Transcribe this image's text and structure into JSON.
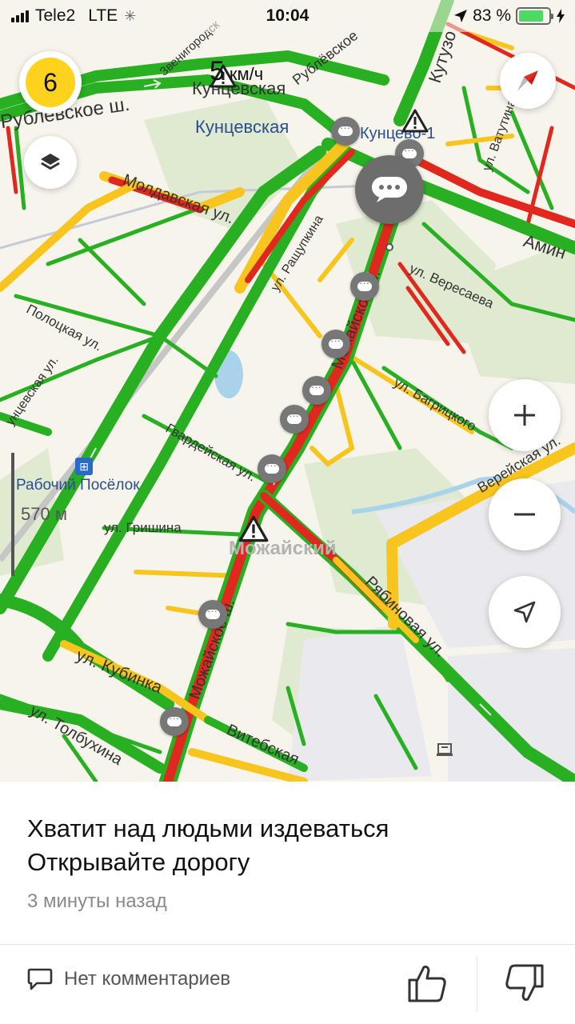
{
  "status_bar": {
    "carrier": "Tele2",
    "network": "LTE",
    "time": "10:04",
    "battery_percent": "83 %",
    "battery_level": 0.83
  },
  "map": {
    "traffic_score": "6",
    "speed_value": "5",
    "speed_unit": "км/ч",
    "scale_label": "570 м",
    "labels": {
      "rublevskoe": "Рублёвское ш.",
      "rublevskoe_top": "Рублёвское",
      "zvenigorodskoe": "Звенигородск",
      "kuntsevskaya_st": "Кунцевская",
      "kuntsevskaya_top": "Кунцевская",
      "kuntsevo1": "Кунцево-1",
      "kutuzovsky": "Кутузо",
      "moldavskaya": "Молдавская ул.",
      "rashchupkina": "ул. Ращупкина",
      "mozhayskoe_upper": "Можайское ш.",
      "mozhayskoe_lower": "Можайское ш.",
      "veresaeva": "ул. Вересаева",
      "vatutina": "ул. Ватутина",
      "aminyevskoe": "Амин",
      "polotskaya": "Полоцкая ул.",
      "kuntsevskaya_ul": "унцевская ул.",
      "bagritskogo": "ул. Багрицкого",
      "gvardeyskaya": "Гвардейская ул.",
      "rabochiy_poselok": "Рабочий Посёлок",
      "grishina": "ул. Гришина",
      "mozhayskiy": "Можайский",
      "vereyskaya": "Верейская ул.",
      "ryabinovaya": "Рябиновая ул.",
      "kubinka": "ул. Кубинка",
      "tolbukhina": "ул. Толбухина",
      "vitebskaya": "Витебская"
    },
    "icons": {
      "traffic": "traffic-score-icon",
      "layers": "layers-icon",
      "compass": "compass-icon",
      "zoom_in": "plus-icon",
      "zoom_out": "minus-icon",
      "locate": "location-arrow-icon"
    },
    "colors": {
      "jam": "#e0281e",
      "slow": "#f7c51d",
      "free": "#28b022",
      "score": "#ffd21e"
    }
  },
  "card": {
    "message_line1": "Хватит над людьми издеваться",
    "message_line2": "Открывайте дорогу",
    "time_ago": "3 минуты назад",
    "comments_label": "Нет комментариев"
  }
}
